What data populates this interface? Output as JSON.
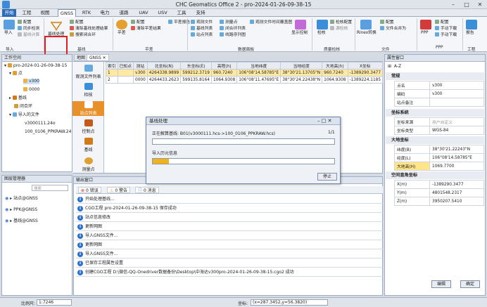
{
  "window": {
    "title": "CHC Geomatics Office 2 - pro-2024-01-26-09-38-15"
  },
  "menu": [
    "开始",
    "工程",
    "视图",
    "GNSS",
    "RTK",
    "电力",
    "道路",
    "UAV",
    "USV",
    "工具",
    "支持"
  ],
  "ribbon": {
    "import": "导入",
    "config": "配置",
    "sync_check": "同步检测",
    "static_calc": "基线计算",
    "baseline_process": "基线处理",
    "clear_baseline_result": "清除基线处理结果",
    "search_loop": "搜索闭合环",
    "adjust": "平差",
    "adj_config": "配置",
    "clear_adj": "清除平差结果",
    "adj_report": "平差报告",
    "view_files": "观测文件",
    "baseline_list": "基线列表",
    "station_list": "站点列表",
    "measure_pts": "测量点",
    "loop_list": "闭合环列表",
    "route_list": "线路序列图",
    "obs_time": "观测文件时间覆盖图",
    "display_ctrl": "显示控制",
    "check": "检核",
    "check_config": "检核配置",
    "source_check": "源检核",
    "rinex": "Rinex转换",
    "ppp_config": "配置",
    "file_save_as": "文件合并为",
    "ppp": "PPP",
    "manual_dl": "手动下载",
    "auto_dl": "手动下载",
    "report": "报告",
    "groups": [
      "导入",
      "基线",
      "平差",
      "数据面板",
      "质量检核",
      "文件",
      "PPP",
      "工程"
    ]
  },
  "project_panel": {
    "title": "工作空间",
    "project": "pro-2024-01-26-09-38-15",
    "points": "点",
    "pt1": "v300",
    "pt2": "0000",
    "baseline": "基线",
    "loop": "闭合环",
    "imported": "导入的文件",
    "file1": "v3000111.24o",
    "file2": "100_0106_PPKRAW.24"
  },
  "layer_panel": {
    "title": "图层管理器",
    "search_placeholder": "搜索",
    "items": [
      "站点@GNSS",
      "PPK@GNSS",
      "基线@GNSS"
    ]
  },
  "tabs": [
    "地图",
    "GNSS"
  ],
  "vtool": [
    "观测文件列表",
    "检核",
    "站点列表",
    "控制点",
    "基线",
    "测量点"
  ],
  "table": {
    "headers": [
      "索引",
      "已知点",
      "测站",
      "北坐标(N)",
      "东坐标(E)",
      "高程(h)",
      "当地纬度",
      "当地经度",
      "大地高(h)",
      "X坐标"
    ],
    "rows": [
      [
        "1",
        "",
        "v300",
        "4264338.9899",
        "599212.3719",
        "960.7240",
        "106°08'14.58785\"E",
        "38°30'21.13705\"N",
        "960.7240",
        "-1389290.3477"
      ],
      [
        "2",
        "",
        "0000",
        "4264433.2623",
        "599135.8164",
        "1064.9308",
        "106°08'11.47695\"E",
        "38°30'24.22438\"N",
        "1064.9308",
        "-1389224.1185"
      ]
    ]
  },
  "dialog": {
    "title": "基线处理",
    "line1": "正在解算基线: B01(v3000111.hcs->100_0106_PPKRAW.hcs)",
    "count": "1/1",
    "progress1": 0,
    "label2": "导入历元信息",
    "progress2": 0.09,
    "stop": "停止"
  },
  "output": {
    "title": "输出窗口",
    "errors": "0 错误",
    "warnings": "0 警告",
    "msgs": "0 消息",
    "lines": [
      "开始处理基线...",
      "CGO工程 pro-2024-01-26-09-38-15 保存成功",
      "站点信息修改",
      "更新网图",
      "导入GNSS文件...",
      "更新网图",
      "导入GNSS文件...",
      "已保存工程属性设置",
      "创建CGO工程 D:\\微信-QQ-Onedriver数据备份\\Desktop\\中海达v300pro-2024-01-26-09-38-15.cgo2 成功"
    ]
  },
  "props": {
    "title": "属性窗口",
    "groups": [
      "常规",
      "坐标系统",
      "大地坐标",
      "空间直角坐标"
    ],
    "general": [
      [
        "点名",
        "v300"
      ],
      [
        "编码",
        "v300"
      ],
      [
        "站点备注",
        ""
      ]
    ],
    "coord": [
      [
        "坐标来源",
        "用户自定义"
      ],
      [
        "坐标类型",
        "WGS-84"
      ]
    ],
    "geo": [
      [
        "纬度(B)",
        "38°30'21.22243\"N"
      ],
      [
        "经度(L)",
        "106°08'14.58785\"E"
      ],
      [
        "大地高(H)",
        "1069.7700"
      ]
    ],
    "xyz": [
      [
        "X(m)",
        "-1389290.3477"
      ],
      [
        "Y(m)",
        "4801548.2317"
      ],
      [
        "Z(m)",
        "3950207.5410"
      ]
    ],
    "edit": "编辑",
    "ok": "确定"
  },
  "status": {
    "scale_label": "比例尺:",
    "scale": "1:7246",
    "coord_label": "坐标:",
    "coord": "(x=287.3452,y=56.3820)"
  }
}
